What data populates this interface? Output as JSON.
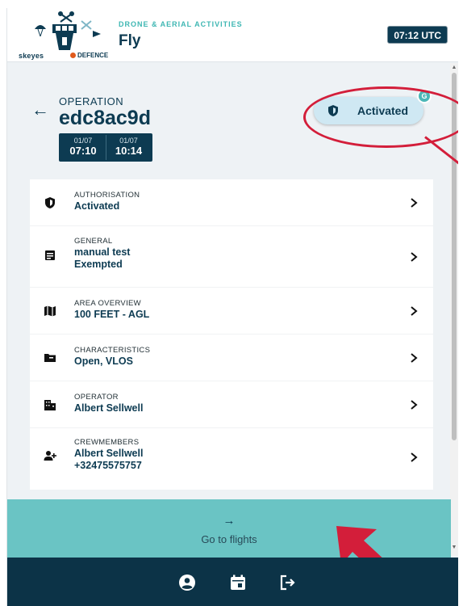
{
  "header": {
    "logo_word": "skeyes",
    "logo_partner": "DEFENCE",
    "subtitle": "DRONE & AERIAL ACTIVITIES",
    "title": "Fly",
    "utc_time": "07:12 UTC"
  },
  "operation": {
    "label": "OPERATION",
    "id": "edc8ac9d",
    "start": {
      "date": "01/07",
      "time": "07:10"
    },
    "end": {
      "date": "01/07",
      "time": "10:14"
    }
  },
  "status": {
    "label": "Activated",
    "badge": "G",
    "icon": "shield-icon"
  },
  "rows": [
    {
      "label": "AUTHORISATION",
      "values": [
        "Activated"
      ],
      "icon": "shield-icon"
    },
    {
      "label": "GENERAL",
      "values": [
        "manual test",
        "Exempted"
      ],
      "icon": "document-icon"
    },
    {
      "label": "AREA OVERVIEW",
      "values": [
        "100 FEET - AGL"
      ],
      "icon": "map-icon"
    },
    {
      "label": "CHARACTERISTICS",
      "values": [
        "Open, VLOS"
      ],
      "icon": "folder-icon"
    },
    {
      "label": "OPERATOR",
      "values": [
        "Albert Sellwell"
      ],
      "icon": "building-icon"
    },
    {
      "label": "CREWMEMBERS",
      "values": [
        "Albert Sellwell",
        "+32475575757"
      ],
      "icon": "person-add-icon"
    }
  ],
  "go_to_flights": {
    "arrow": "→",
    "label": "Go to flights"
  },
  "bottom_nav": {
    "items": [
      "account-icon",
      "calendar-icon",
      "logout-icon"
    ]
  },
  "colors": {
    "navy": "#0d3b52",
    "teal": "#6ac4c4",
    "accent_teal": "#3fb7b3",
    "status_bg": "#cfe8f3",
    "annotation_red": "#d31e3a"
  }
}
